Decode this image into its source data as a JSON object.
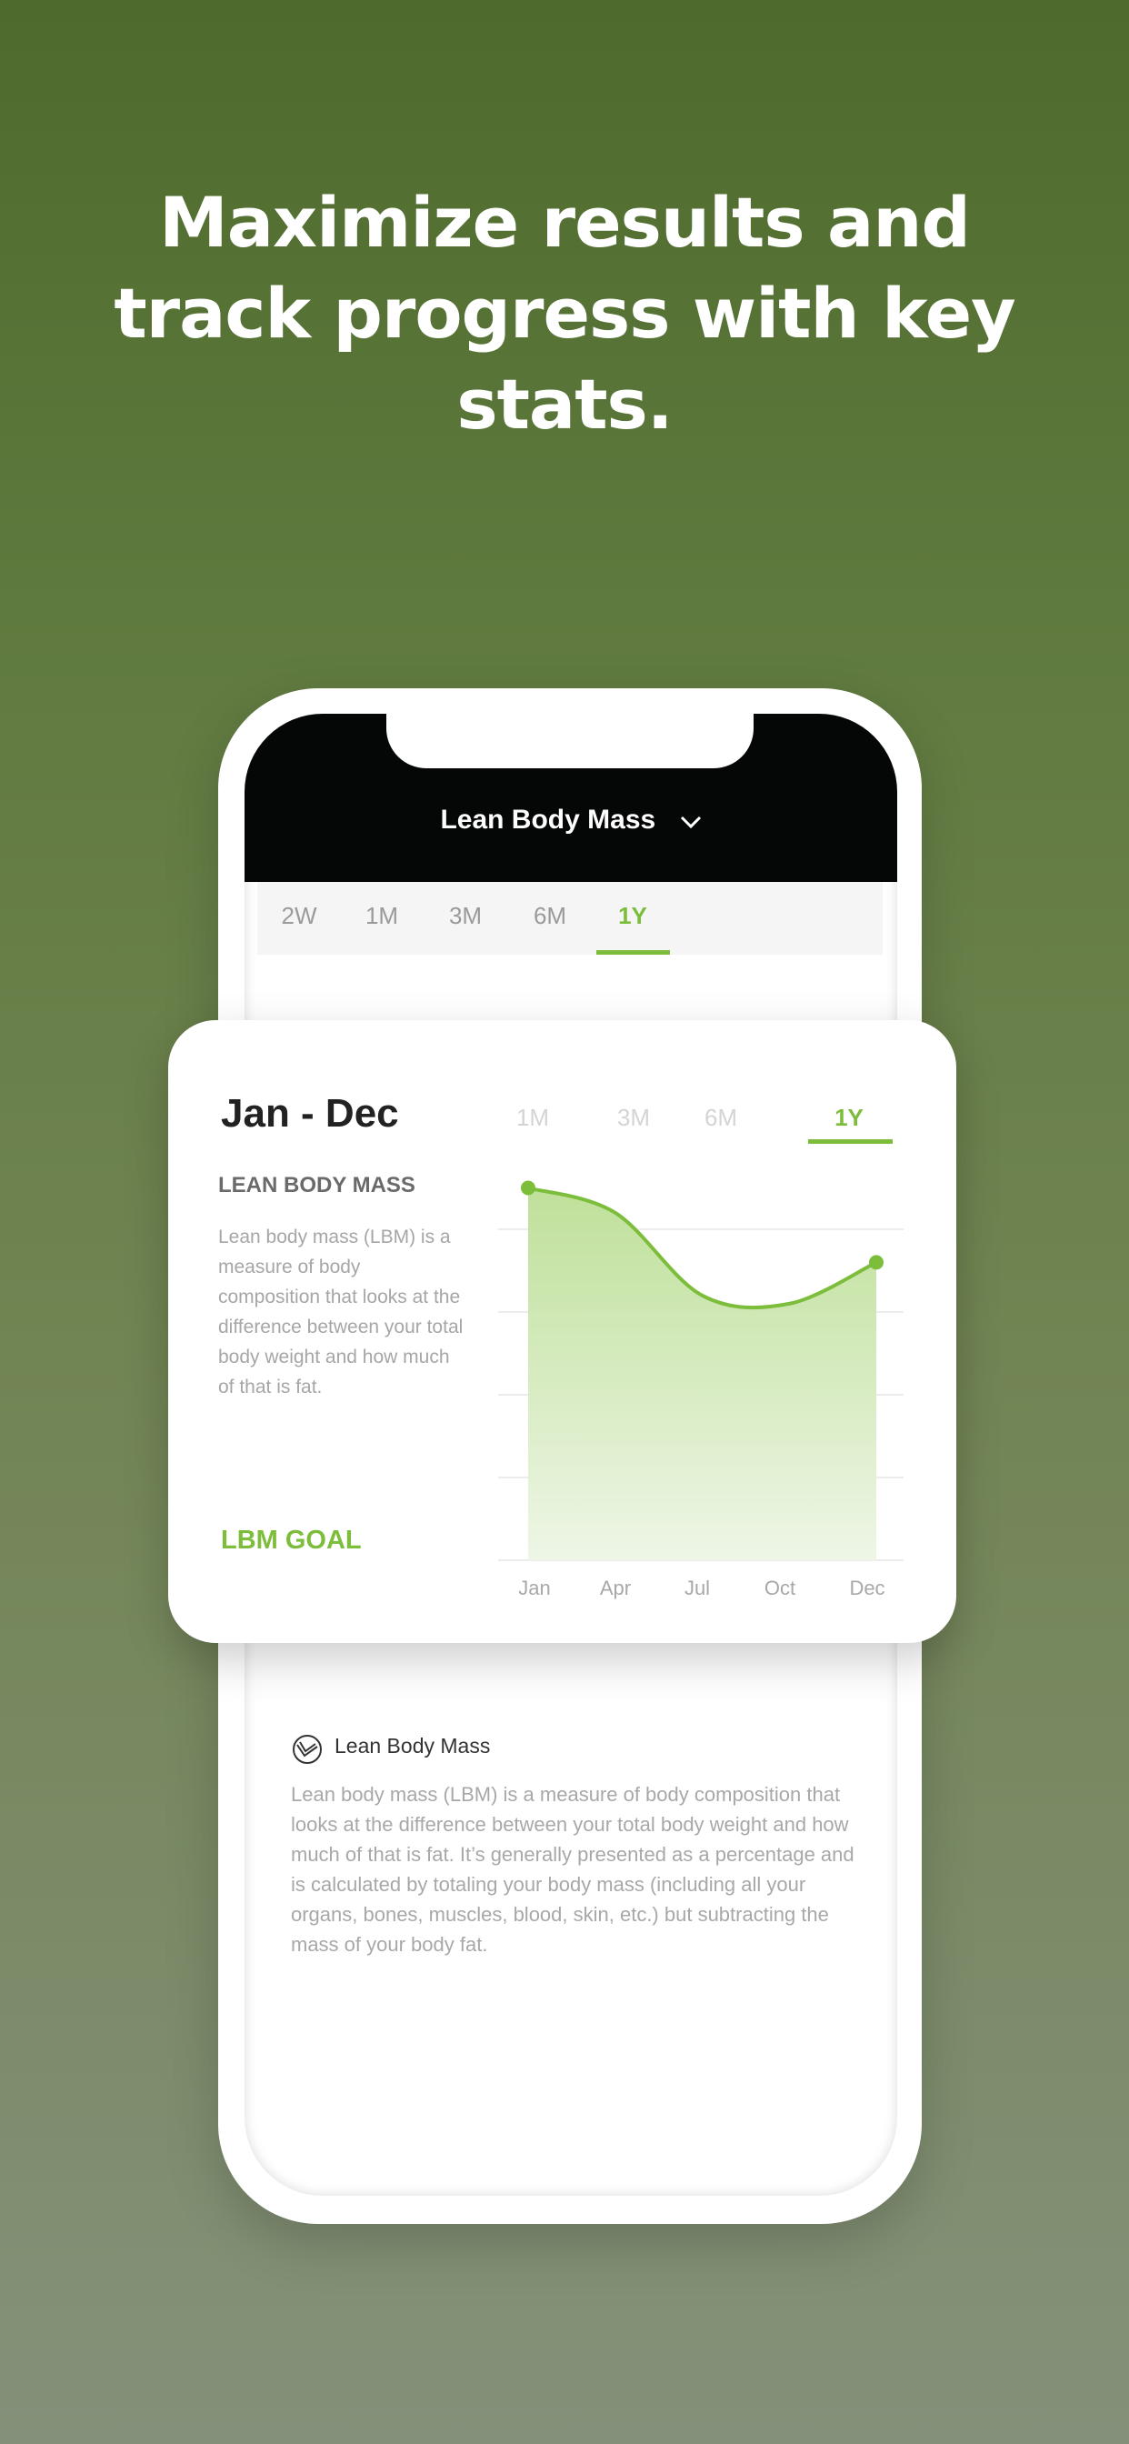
{
  "headline": [
    "Maximize results and",
    "track progress with key",
    "stats."
  ],
  "header": {
    "title": "Lean Body Mass",
    "icon": "chevron-down-icon"
  },
  "tabs": [
    {
      "label": "2W"
    },
    {
      "label": "1M"
    },
    {
      "label": "3M"
    },
    {
      "label": "6M"
    },
    {
      "label": "1Y",
      "active": true
    }
  ],
  "card": {
    "range": "Jan - Dec",
    "tabs": [
      {
        "label": "1M"
      },
      {
        "label": "3M"
      },
      {
        "label": "6M"
      },
      {
        "label": "1Y",
        "active": true
      }
    ],
    "heading": "LEAN BODY MASS",
    "description": "Lean body mass (LBM) is a measure of body composition that looks at the difference between your total body weight and how much of that is fat.",
    "goal_label": "LBM GOAL"
  },
  "info": {
    "icon": "lean-body-mass-icon",
    "title": "Lean Body Mass",
    "text": "Lean body mass (LBM) is a measure of body composition that looks at the difference between your total body weight and how much of that is fat. It’s generally presented as a percentage and is calculated by totaling your body mass (including all your organs, bones, muscles, blood, skin, etc.) but subtracting the mass of your body fat."
  },
  "colors": {
    "accent": "#7dbd3c",
    "header_bg": "#050606"
  },
  "chart_data": {
    "type": "area",
    "categories": [
      "Jan",
      "Apr",
      "Jul",
      "Oct",
      "Dec"
    ],
    "values": [
      4.5,
      4.2,
      3.2,
      3.1,
      3.6
    ],
    "ylim": [
      0,
      4.6
    ],
    "grid": true,
    "y_ticks_shown": false,
    "markers": [
      "Jan",
      "Dec"
    ]
  }
}
